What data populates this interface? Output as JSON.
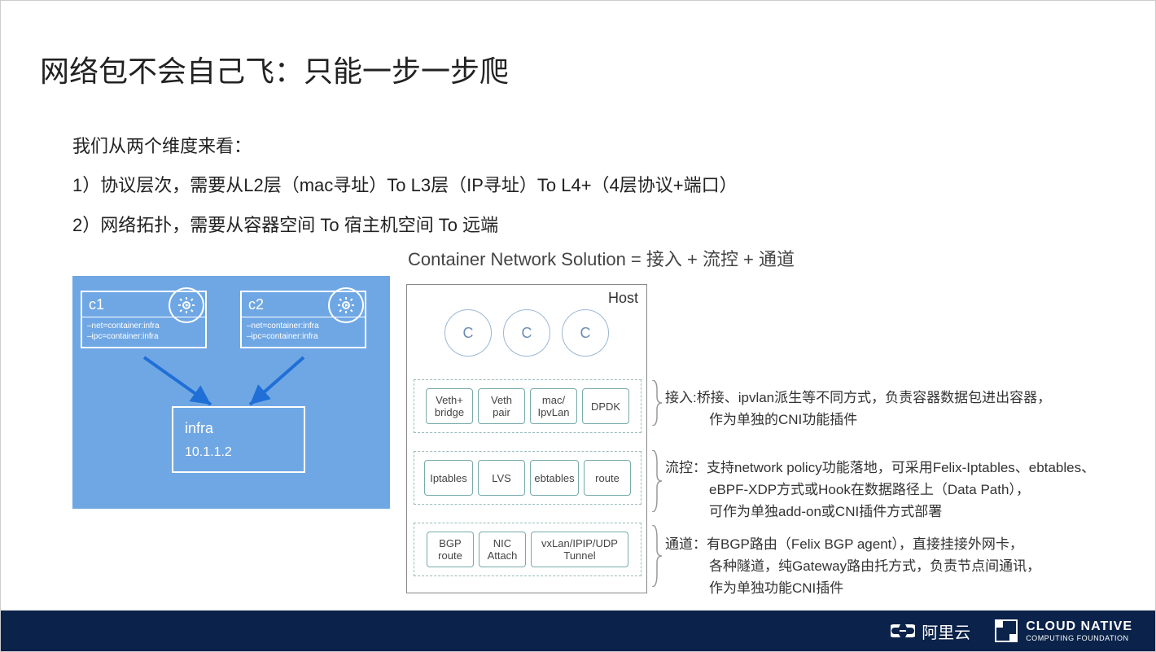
{
  "title": "网络包不会自己飞：只能一步一步爬",
  "intro": {
    "line0": "我们从两个维度来看：",
    "line1": "1）协议层次，需要从L2层（mac寻址）To  L3层（IP寻址）To  L4+（4层协议+端口）",
    "line2": "2）网络拓扑，需要从容器空间 To  宿主机空间 To 远端"
  },
  "formula": "Container Network Solution = 接入 + 流控 + 通道",
  "left": {
    "c1": {
      "name": "c1",
      "sub1": "–net=container:infra",
      "sub2": "–ipc=container:infra"
    },
    "c2": {
      "name": "c2",
      "sub1": "–net=container:infra",
      "sub2": "–ipc=container:infra"
    },
    "infra": {
      "name": "infra",
      "ip": "10.1.1.2"
    }
  },
  "host": {
    "label": "Host",
    "circle_label": "C",
    "row1": [
      "Veth+\nbridge",
      "Veth\npair",
      "mac/\nIpvLan",
      "DPDK"
    ],
    "row2": [
      "Iptables",
      "LVS",
      "ebtables",
      "route"
    ],
    "row3": [
      "BGP\nroute",
      "NIC\nAttach",
      "vxLan/IPIP/UDP\nTunnel"
    ]
  },
  "desc": {
    "r1a": "接入:桥接、ipvlan派生等不同方式，负责容器数据包进出容器，",
    "r1b": "作为单独的CNI功能插件",
    "r2a": "流控：支持network policy功能落地，可采用Felix-Iptables、ebtables、",
    "r2b": "eBPF-XDP方式或Hook在数据路径上（Data Path），",
    "r2c": "可作为单独add-on或CNI插件方式部署",
    "r3a": "通道：有BGP路由（Felix BGP agent），直接挂接外网卡，",
    "r3b": "各种隧道，纯Gateway路由托方式，负责节点间通讯，",
    "r3c": "作为单独功能CNI插件"
  },
  "footer": {
    "aliyun": "阿里云",
    "cncf1": "CLOUD NATIVE",
    "cncf2": "COMPUTING FOUNDATION"
  }
}
